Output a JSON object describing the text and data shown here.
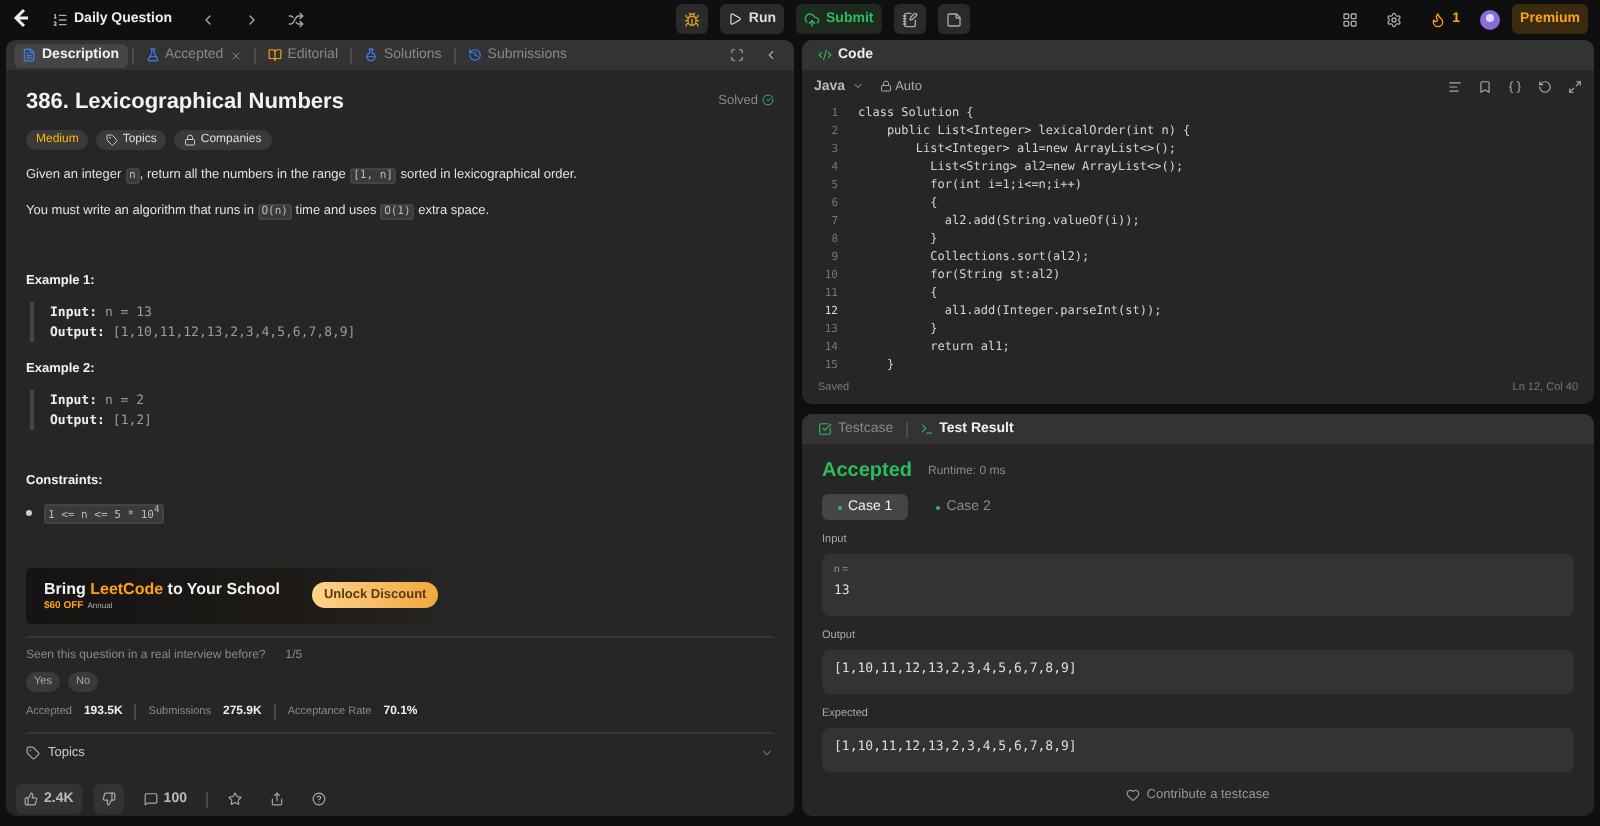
{
  "topbar": {
    "title": "Daily Question",
    "run": "Run",
    "submit": "Submit",
    "streak": "1",
    "premium": "Premium"
  },
  "left_tabs": [
    {
      "label": "Description",
      "selected": true,
      "closable": false
    },
    {
      "label": "Accepted",
      "selected": false,
      "closable": true
    },
    {
      "label": "Editorial",
      "selected": false,
      "closable": false
    },
    {
      "label": "Solutions",
      "selected": false,
      "closable": false
    },
    {
      "label": "Submissions",
      "selected": false,
      "closable": false
    }
  ],
  "problem": {
    "title": "386. Lexicographical Numbers",
    "status": "Solved",
    "difficulty": "Medium",
    "tags": [
      "Topics",
      "Companies"
    ],
    "paragraphs": [
      [
        {
          "text": "Given an integer ",
          "code": false
        },
        {
          "text": "n",
          "code": true
        },
        {
          "text": ", return all the numbers in the range ",
          "code": false
        },
        {
          "text": "[1, n]",
          "code": true
        },
        {
          "text": " sorted in lexicographical order.",
          "code": false
        }
      ],
      [
        {
          "text": "You must write an algorithm that runs in ",
          "code": false
        },
        {
          "text": "O(n)",
          "code": true
        },
        {
          "text": " time and uses ",
          "code": false
        },
        {
          "text": "O(1)",
          "code": true
        },
        {
          "text": " extra space.",
          "code": false
        }
      ]
    ],
    "examples": [
      {
        "heading": "Example 1:",
        "input_label": "Input:",
        "input": "n = 13",
        "output_label": "Output:",
        "output": "[1,10,11,12,13,2,3,4,5,6,7,8,9]"
      },
      {
        "heading": "Example 2:",
        "input_label": "Input:",
        "input": "n = 2",
        "output_label": "Output:",
        "output": "[1,2]"
      }
    ],
    "constraints_heading": "Constraints:",
    "constraints": [
      "1 <= n <= 5 * 10$^{4}$"
    ]
  },
  "promo": {
    "title": [
      {
        "text": "Bring ",
        "brand": false
      },
      {
        "text": "LeetCode",
        "brand": true
      },
      {
        "text": " to Your School",
        "brand": false
      }
    ],
    "offer": "$60 OFF",
    "offer_note": "Annual",
    "button": "Unlock Discount"
  },
  "interview": {
    "question": "Seen this question in a real interview before?",
    "count": "1/5",
    "answers": [
      "Yes",
      "No"
    ]
  },
  "stats": [
    {
      "label": "Accepted",
      "value": "193.5K"
    },
    {
      "label": "Submissions",
      "value": "275.9K"
    },
    {
      "label": "Acceptance Rate",
      "value": "70.1%"
    }
  ],
  "topics_section": "Topics",
  "footer": {
    "likes": "2.4K",
    "comments": "100"
  },
  "code": {
    "title": "Code",
    "language": "Java",
    "mode": "Auto",
    "status": "Saved",
    "cursor": "Ln 12, Col 40",
    "lines": [
      {
        "n": "1",
        "text": "class Solution {",
        "active": false
      },
      {
        "n": "2",
        "text": "    public List<Integer> lexicalOrder(int n) {",
        "active": false
      },
      {
        "n": "3",
        "text": "        List<Integer> al1=new ArrayList<>();",
        "active": false
      },
      {
        "n": "4",
        "text": "          List<String> al2=new ArrayList<>();",
        "active": false
      },
      {
        "n": "5",
        "text": "          for(int i=1;i<=n;i++)",
        "active": false
      },
      {
        "n": "6",
        "text": "          {",
        "active": false
      },
      {
        "n": "7",
        "text": "            al2.add(String.valueOf(i));",
        "active": false
      },
      {
        "n": "8",
        "text": "          }",
        "active": false
      },
      {
        "n": "9",
        "text": "          Collections.sort(al2);",
        "active": false
      },
      {
        "n": "10",
        "text": "          for(String st:al2)",
        "active": false
      },
      {
        "n": "11",
        "text": "          {",
        "active": false
      },
      {
        "n": "12",
        "text": "            al1.add(Integer.parseInt(st));",
        "active": true
      },
      {
        "n": "13",
        "text": "          }",
        "active": false
      },
      {
        "n": "14",
        "text": "          return al1;",
        "active": false
      },
      {
        "n": "15",
        "text": "    }",
        "active": false
      }
    ]
  },
  "result": {
    "tabs": [
      {
        "label": "Testcase",
        "selected": false
      },
      {
        "label": "Test Result",
        "selected": true
      }
    ],
    "verdict": "Accepted",
    "runtime": "Runtime: 0 ms",
    "cases": [
      {
        "label": "Case 1",
        "selected": true
      },
      {
        "label": "Case 2",
        "selected": false
      }
    ],
    "sections": [
      {
        "label": "Input",
        "var": "n =",
        "value": "13"
      },
      {
        "label": "Output",
        "value": "[1,10,11,12,13,2,3,4,5,6,7,8,9]"
      },
      {
        "label": "Expected",
        "value": "[1,10,11,12,13,2,3,4,5,6,7,8,9]"
      }
    ],
    "contribute": "Contribute a testcase"
  }
}
